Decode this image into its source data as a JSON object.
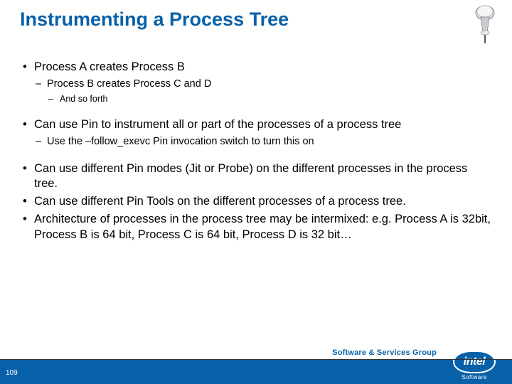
{
  "title": "Instrumenting a Process Tree",
  "bullets": {
    "b1": "Process A creates Process B",
    "b1_1": "Process B creates Process C and D",
    "b1_1_1": "And so forth",
    "b2": "Can use Pin to instrument all or part of the processes of a process tree",
    "b2_1": "Use the –follow_exevc Pin invocation switch to turn this on",
    "b3": "Can use different Pin modes (Jit or Probe) on the different processes in the process tree.",
    "b4": "Can use different Pin Tools on the different processes of a process tree.",
    "b5": "Architecture of processes in the process tree may be intermixed: e.g. Process A is 32bit, Process B is 64 bit, Process C is 64 bit, Process D is 32 bit…"
  },
  "footer": {
    "group": "Software & Services Group",
    "slide_number": "109",
    "brand": "intel",
    "brand_sub": "Software"
  }
}
